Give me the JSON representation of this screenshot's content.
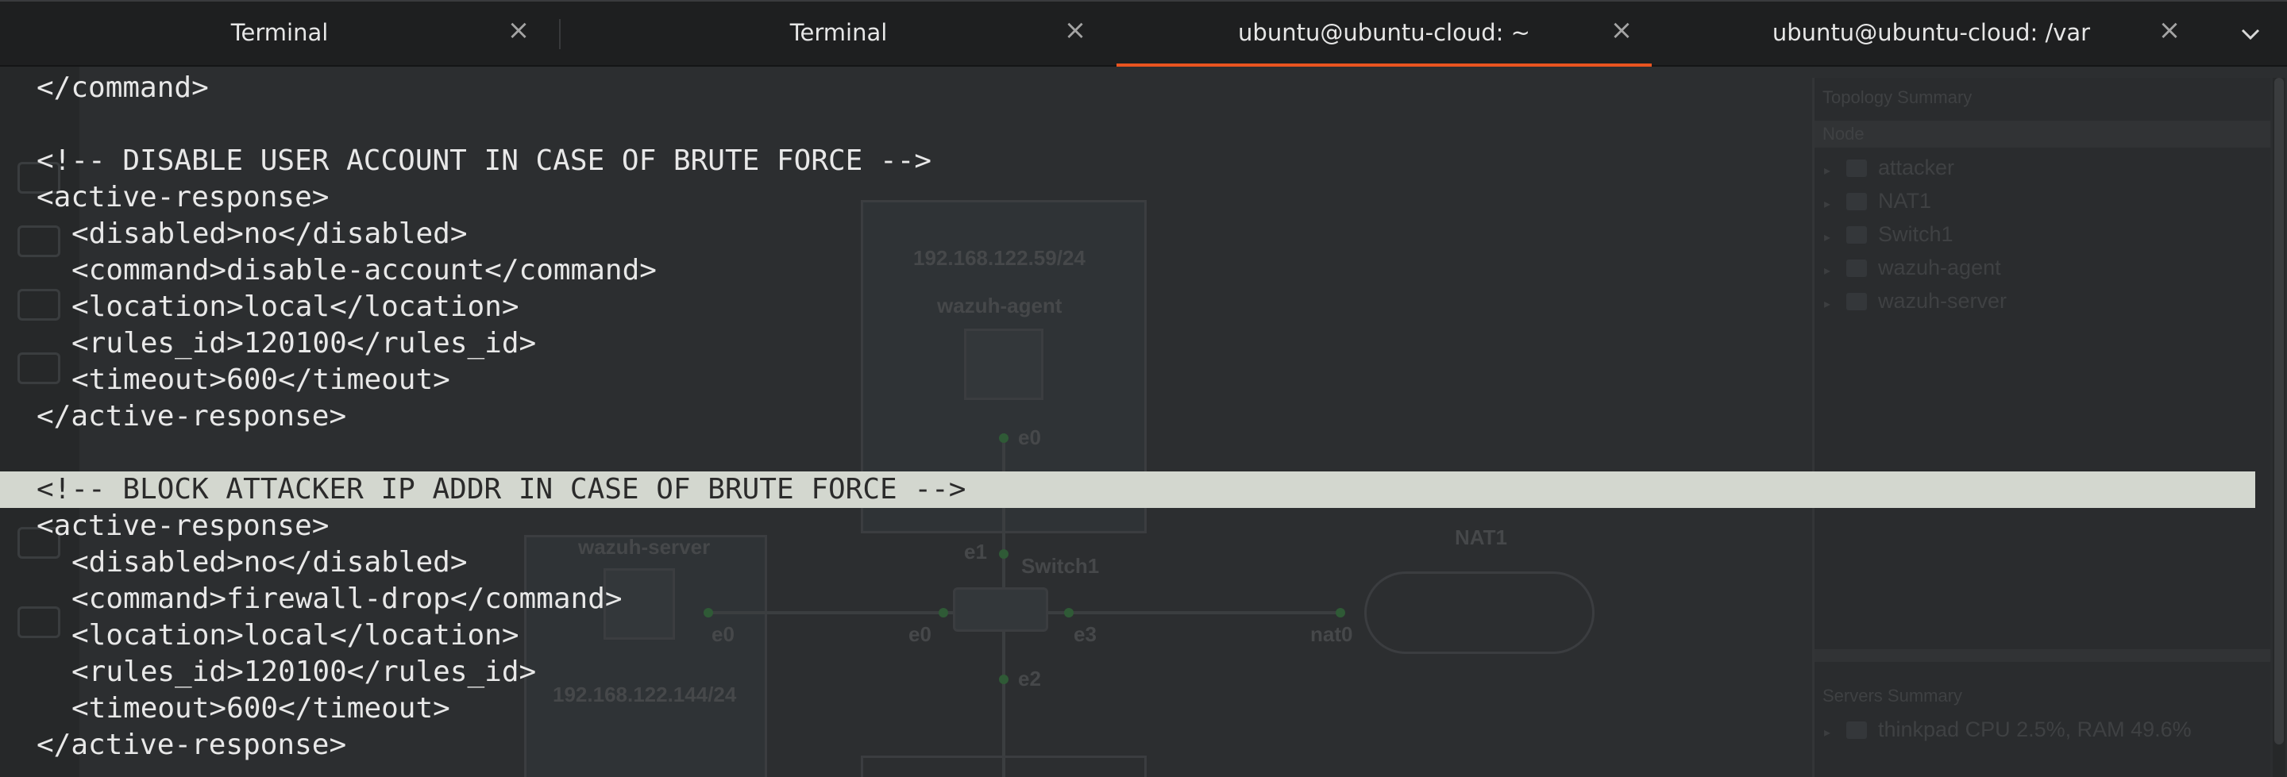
{
  "tabs": [
    {
      "label": "Terminal",
      "active": false
    },
    {
      "label": "Terminal",
      "active": false
    },
    {
      "label": "ubuntu@ubuntu-cloud: ~",
      "active": true
    },
    {
      "label": "ubuntu@ubuntu-cloud: /var",
      "active": false
    }
  ],
  "tab_close_glyph": "×",
  "accent_color": "#e95420",
  "highlight_color": "#d3d7cf",
  "terminal": {
    "lines": [
      "</command>",
      "",
      "<!-- DISABLE USER ACCOUNT IN CASE OF BRUTE FORCE -->",
      "<active-response>",
      "<disabled>no</disabled>",
      "<command>disable-account</command>",
      "<location>local</location>",
      "<rules_id>120100</rules_id>",
      "<timeout>600</timeout>",
      "</active-response>",
      "",
      "<!-- BLOCK ATTACKER IP ADDR IN CASE OF BRUTE FORCE -->",
      "<active-response>",
      "<disabled>no</disabled>",
      "<command>firewall-drop</command>",
      "<location>local</location>",
      "<rules_id>120100</rules_id>",
      "<timeout>600</timeout>",
      "</active-response>"
    ]
  },
  "background": {
    "topology_summary_title": "Topology Summary",
    "nodes_header": "Node",
    "nodes": [
      "attacker",
      "NAT1",
      "Switch1",
      "wazuh-agent",
      "wazuh-server"
    ],
    "servers_summary_title": "Servers Summary",
    "server_status": "thinkpad CPU 2.5%, RAM 49.6%",
    "canvas_labels": {
      "agent_ip": "192.168.122.59/24",
      "agent_name": "wazuh-agent",
      "agent_port": "e0",
      "server_name": "wazuh-server",
      "server_port": "e0",
      "server_ip": "192.168.122.144/24",
      "switch_name": "Switch1",
      "switch_e0": "e0",
      "switch_e1": "e1",
      "switch_e2": "e2",
      "switch_e3": "e3",
      "nat_name": "NAT1",
      "nat_port": "nat0"
    }
  }
}
